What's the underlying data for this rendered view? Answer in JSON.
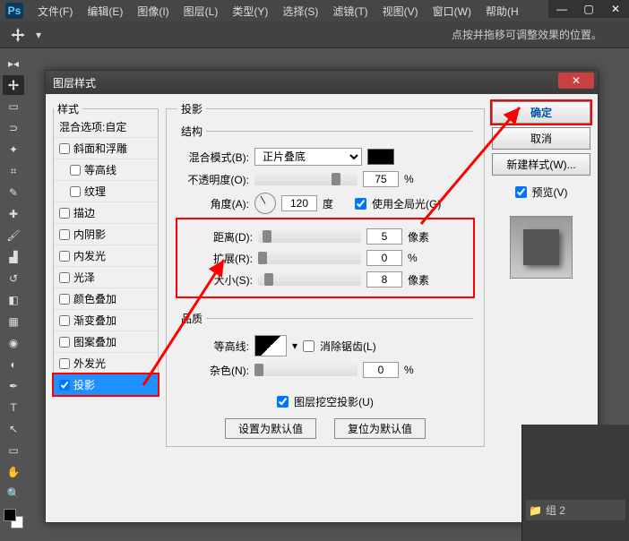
{
  "app": {
    "icon_label": "Ps"
  },
  "menu": {
    "file": "文件(F)",
    "edit": "编辑(E)",
    "image": "图像(I)",
    "layer": "图层(L)",
    "type": "类型(Y)",
    "select": "选择(S)",
    "filter": "滤镜(T)",
    "view": "视图(V)",
    "window": "窗口(W)",
    "help": "帮助(H"
  },
  "optionsbar": {
    "hint": "点按并拖移可调整效果的位置。"
  },
  "dialog": {
    "title": "图层样式",
    "styles_legend": "样式",
    "styles": [
      {
        "label": "混合选项:自定",
        "checkbox": false
      },
      {
        "label": "斜面和浮雕",
        "checkbox": true,
        "checked": false
      },
      {
        "label": "等高线",
        "checkbox": true,
        "checked": false,
        "indent": true
      },
      {
        "label": "纹理",
        "checkbox": true,
        "checked": false,
        "indent": true
      },
      {
        "label": "描边",
        "checkbox": true,
        "checked": false
      },
      {
        "label": "内阴影",
        "checkbox": true,
        "checked": false
      },
      {
        "label": "内发光",
        "checkbox": true,
        "checked": false
      },
      {
        "label": "光泽",
        "checkbox": true,
        "checked": false
      },
      {
        "label": "颜色叠加",
        "checkbox": true,
        "checked": false
      },
      {
        "label": "渐变叠加",
        "checkbox": true,
        "checked": false
      },
      {
        "label": "图案叠加",
        "checkbox": true,
        "checked": false
      },
      {
        "label": "外发光",
        "checkbox": true,
        "checked": false
      },
      {
        "label": "投影",
        "checkbox": true,
        "checked": true,
        "selected": true
      }
    ],
    "settings": {
      "legend": "投影",
      "structure_legend": "结构",
      "blend_mode_label": "混合模式(B):",
      "blend_mode_value": "正片叠底",
      "opacity_label": "不透明度(O):",
      "opacity_value": "75",
      "opacity_unit": "%",
      "angle_label": "角度(A):",
      "angle_value": "120",
      "angle_unit": "度",
      "global_light_label": "使用全局光(G)",
      "global_light_checked": true,
      "distance_label": "距离(D):",
      "distance_value": "5",
      "distance_unit": "像素",
      "spread_label": "扩展(R):",
      "spread_value": "0",
      "spread_unit": "%",
      "size_label": "大小(S):",
      "size_value": "8",
      "size_unit": "像素",
      "quality_legend": "品质",
      "contour_label": "等高线:",
      "antialias_label": "消除锯齿(L)",
      "noise_label": "杂色(N):",
      "noise_value": "0",
      "noise_unit": "%",
      "knockout_label": "图层挖空投影(U)",
      "knockout_checked": true,
      "set_default": "设置为默认值",
      "reset_default": "复位为默认值"
    },
    "buttons": {
      "ok": "确定",
      "cancel": "取消",
      "new_style": "新建样式(W)...",
      "preview_label": "预览(V)",
      "preview_checked": true
    }
  },
  "bottom_right": {
    "group_label": "组 2"
  }
}
